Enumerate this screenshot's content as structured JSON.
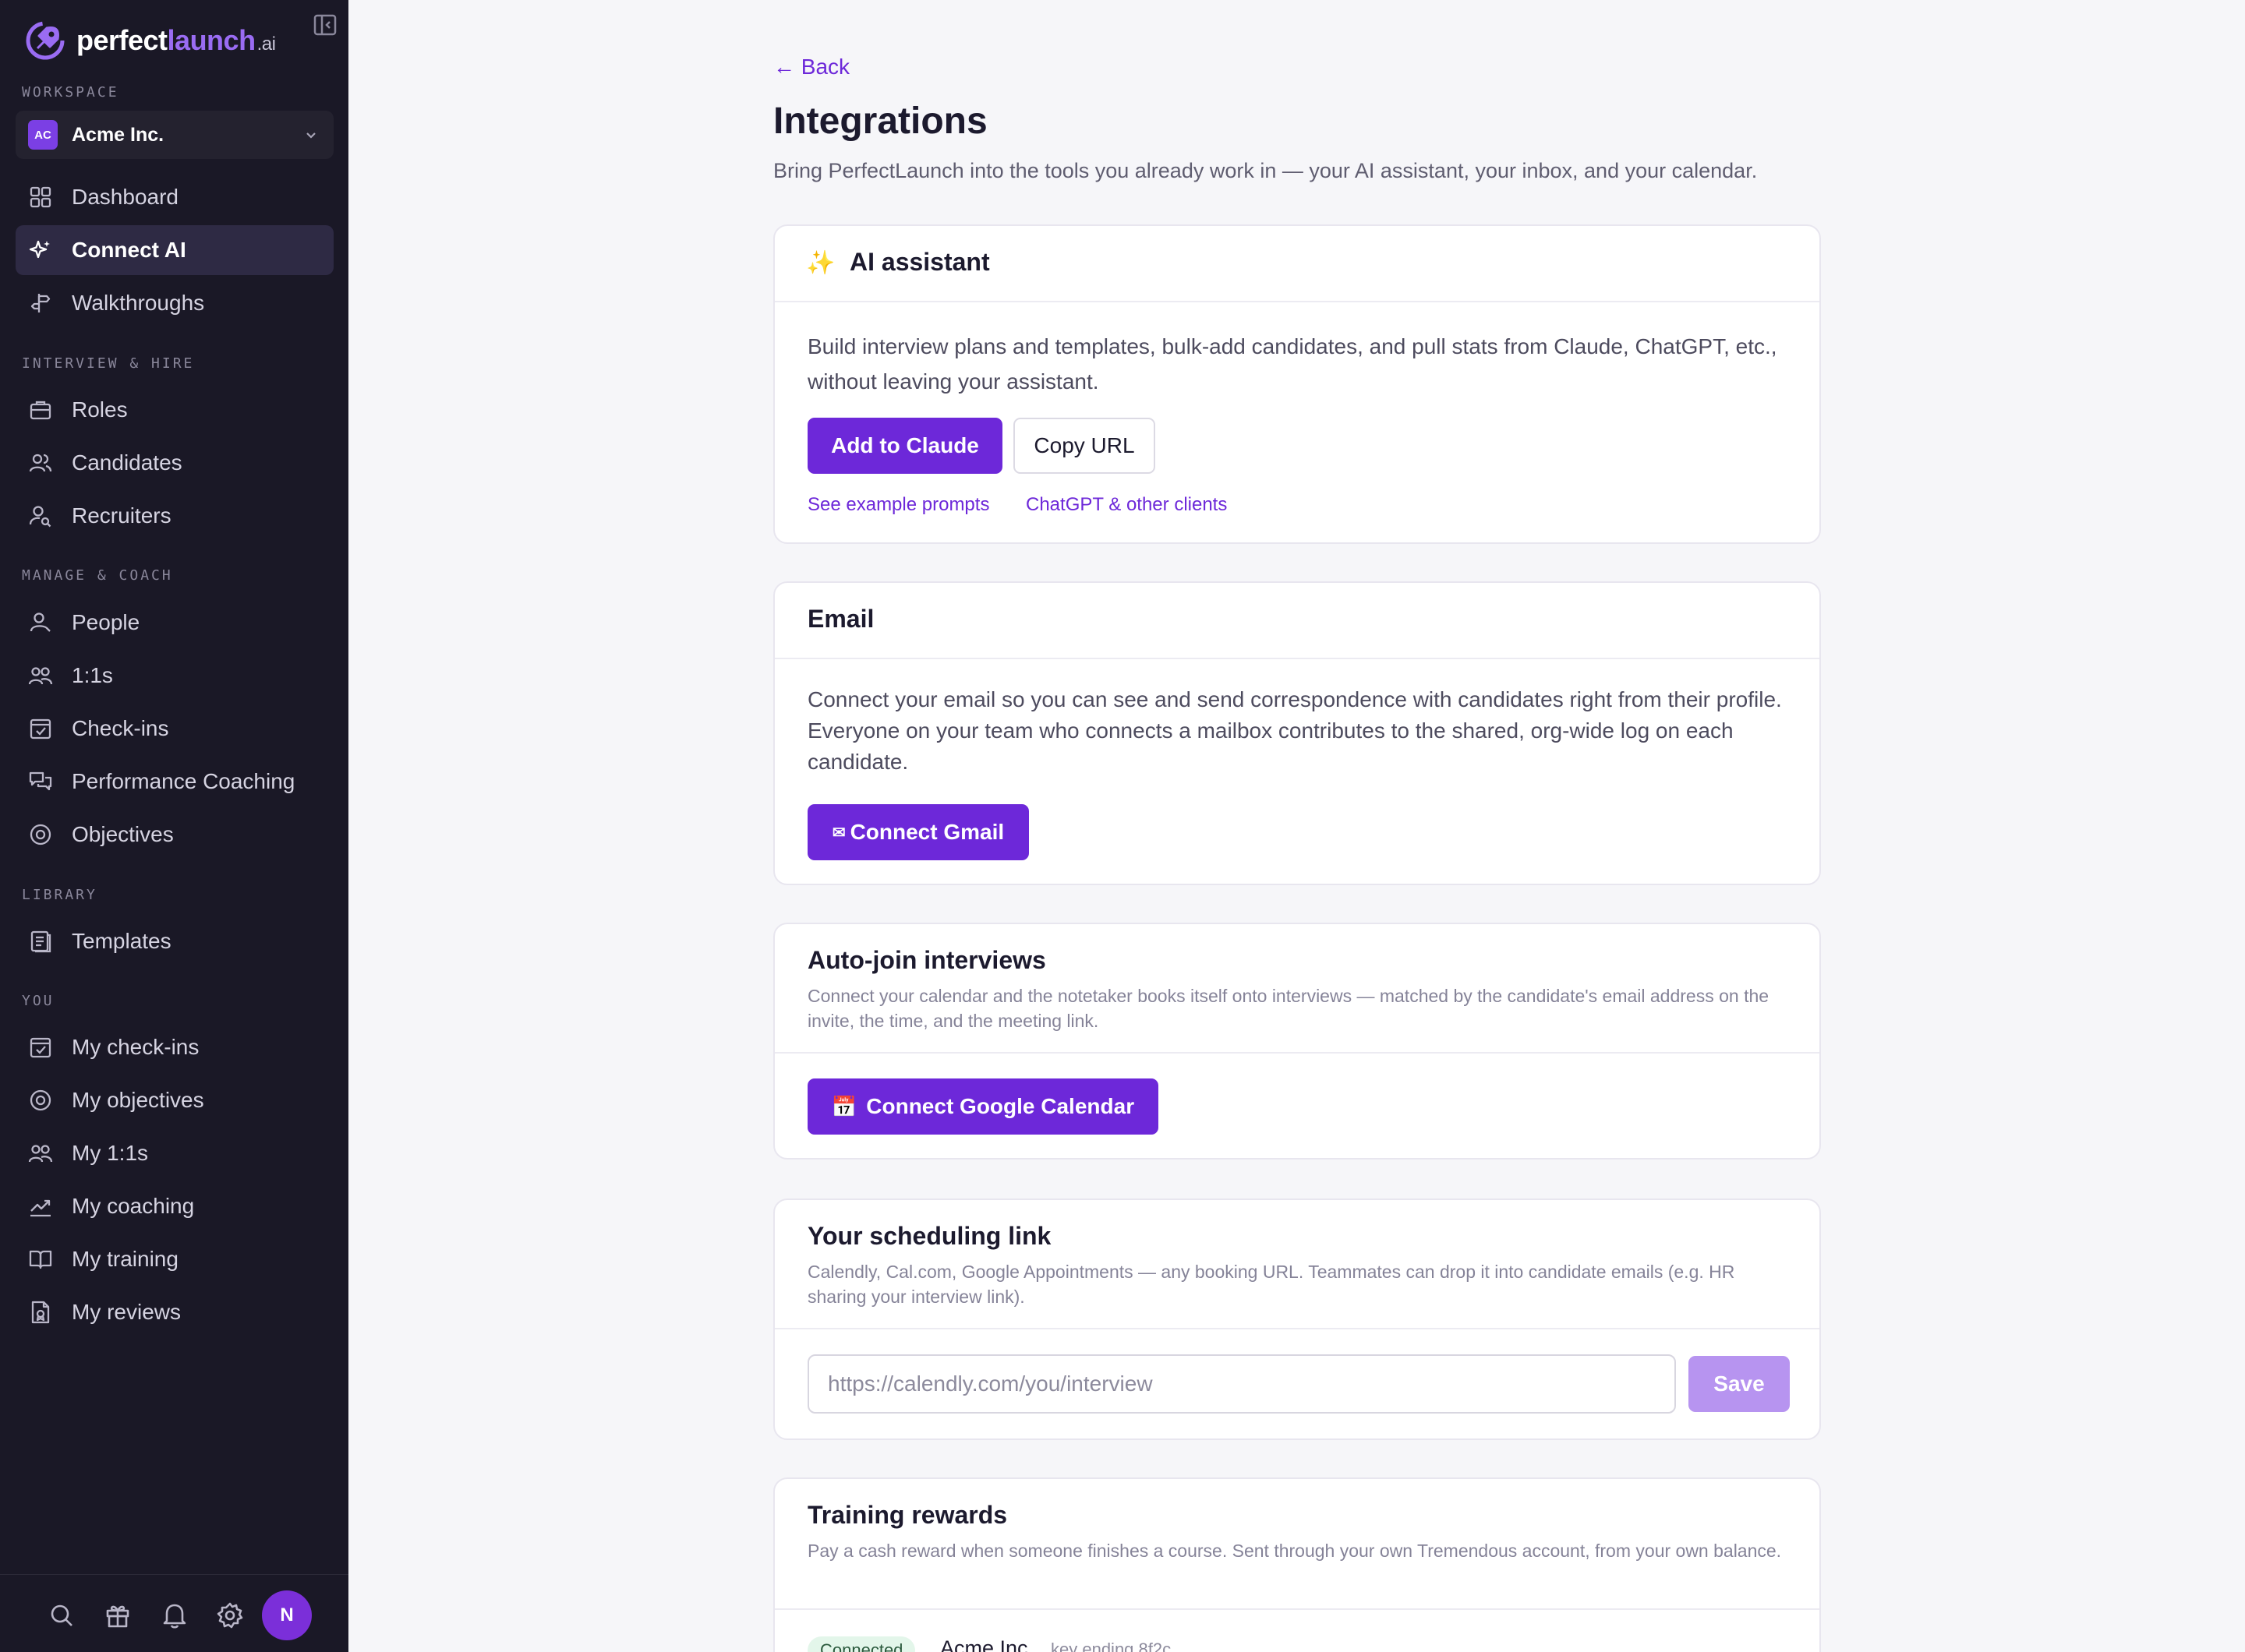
{
  "brand": {
    "name_part1": "perfect",
    "name_part2": "launch",
    "name_suffix": ".ai",
    "accent_color": "#9a6cf3"
  },
  "sidebar": {
    "workspace_label": "WORKSPACE",
    "workspace": {
      "badge": "AC",
      "name": "Acme Inc."
    },
    "top_items": [
      {
        "label": "Dashboard",
        "icon": "grid-icon"
      },
      {
        "label": "Connect AI",
        "icon": "sparkle-icon",
        "active": true
      },
      {
        "label": "Walkthroughs",
        "icon": "signpost-icon"
      }
    ],
    "section_interview": "INTERVIEW & HIRE",
    "interview_items": [
      {
        "label": "Roles",
        "icon": "briefcase-icon"
      },
      {
        "label": "Candidates",
        "icon": "users-icon"
      },
      {
        "label": "Recruiters",
        "icon": "user-search-icon"
      }
    ],
    "section_manage": "MANAGE & COACH",
    "manage_items": [
      {
        "label": "People",
        "icon": "user-icon"
      },
      {
        "label": "1:1s",
        "icon": "two-users-icon"
      },
      {
        "label": "Check-ins",
        "icon": "calendar-check-icon"
      },
      {
        "label": "Performance Coaching",
        "icon": "chat-bubbles-icon"
      },
      {
        "label": "Objectives",
        "icon": "target-icon"
      }
    ],
    "section_library": "LIBRARY",
    "library_items": [
      {
        "label": "Templates",
        "icon": "document-icon"
      }
    ],
    "section_you": "YOU",
    "you_items": [
      {
        "label": "My check-ins",
        "icon": "calendar-check-icon"
      },
      {
        "label": "My objectives",
        "icon": "target-icon"
      },
      {
        "label": "My 1:1s",
        "icon": "two-users-icon"
      },
      {
        "label": "My coaching",
        "icon": "trend-up-icon"
      },
      {
        "label": "My training",
        "icon": "book-icon"
      },
      {
        "label": "My reviews",
        "icon": "file-badge-icon"
      }
    ],
    "footer": {
      "avatar_initial": "N"
    }
  },
  "main": {
    "back_label": "← Back",
    "title": "Integrations",
    "subtitle": "Bring PerfectLaunch into the tools you already work in — your AI assistant, your inbox, and your calendar.",
    "ai_card": {
      "icon": "✨",
      "title": "AI assistant",
      "description": "Build interview plans and templates, bulk-add candidates, and pull stats from Claude, ChatGPT, etc., without leaving your assistant.",
      "primary_button": "Add to Claude",
      "secondary_button": "Copy URL",
      "link_prompts": "See example prompts",
      "link_clients": "ChatGPT & other clients"
    },
    "email_card": {
      "title": "Email",
      "description": "Connect your email so you can see and send correspondence with candidates right from their profile. Everyone on your team who connects a mailbox contributes to the shared, org-wide log on each candidate.",
      "button_icon": "✉",
      "button": "Connect Gmail"
    },
    "autojoin_card": {
      "title": "Auto-join interviews",
      "description": "Connect your calendar and the notetaker books itself onto interviews — matched by the candidate's email address on the invite, the time, and the meeting link.",
      "button_icon": "📅",
      "button": "Connect Google Calendar"
    },
    "scheduling_card": {
      "title": "Your scheduling link",
      "description": "Calendly, Cal.com, Google Appointments — any booking URL. Teammates can drop it into candidate emails (e.g. HR sharing your interview link).",
      "input_placeholder": "https://calendly.com/you/interview",
      "input_value": "",
      "save_button": "Save"
    },
    "rewards_card": {
      "title": "Training rewards",
      "description": "Pay a cash reward when someone finishes a course. Sent through your own Tremendous account, from your own balance.",
      "status": "Connected",
      "account_name": "Acme Inc",
      "key_info": "key ending 8f2c"
    }
  },
  "colors": {
    "sidebar_bg": "#1a1826",
    "primary": "#6d28d9",
    "primary_disabled": "#b794f0",
    "page_bg": "#f6f6f9"
  }
}
